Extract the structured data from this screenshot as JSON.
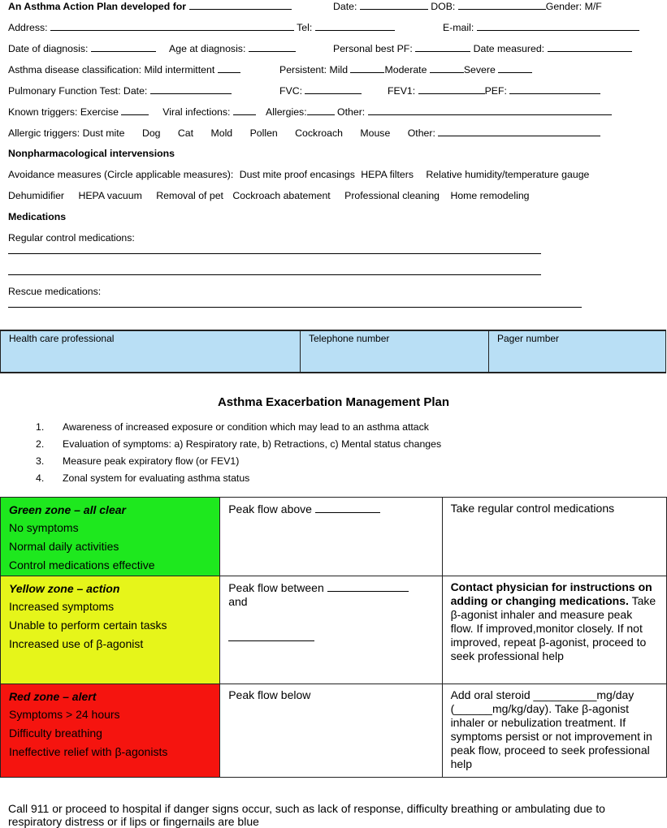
{
  "form": {
    "title": "An Asthma Action Plan developed for",
    "date_label": "Date:",
    "dob_label": "DOB:",
    "gender_label": "Gender: M/F",
    "address_label": "Address:",
    "tel_label": "Tel:",
    "email_label": "E-mail:",
    "date_of_diagnosis_label": "Date of diagnosis:",
    "age_at_diagnosis_label": "Age at diagnosis:",
    "personal_best_label": "Personal best PF:",
    "date_measured_label": "Date measured:",
    "classification_label": "Asthma disease classification: Mild intermittent",
    "persistent_label": "Persistent:  Mild",
    "moderate_label": "Moderate",
    "severe_label": "Severe",
    "pft_label": "Pulmonary Function Test: Date:",
    "fvc_label": "FVC:",
    "fev1_label": "FEV1:",
    "pef_label": "PEF:",
    "known_triggers_label": "Known triggers: Exercise",
    "viral_label": "Viral infections:",
    "allergies_label": "Allergies:",
    "other_label": "Other:",
    "allergic_triggers_label": "Allergic triggers: Dust mite",
    "allergic_triggers": [
      "Dog",
      "Cat",
      "Mold",
      "Pollen",
      "Cockroach",
      "Mouse"
    ],
    "allergic_other_label": "Other:"
  },
  "nonpharm": {
    "heading": "Nonpharmacological intervensions",
    "avoidance_label": "Avoidance measures (Circle applicable measures):",
    "measures_row1": [
      "Dust mite proof encasings",
      "HEPA filters",
      "Relative humidity/temperature gauge"
    ],
    "measures_row2": [
      "Dehumidifier",
      "HEPA vacuum",
      "Removal of pet",
      "Cockroach abatement",
      "Professional cleaning",
      "Home remodeling"
    ]
  },
  "medications": {
    "heading": "Medications",
    "regular_label": "Regular control medications:",
    "rescue_label": "Rescue medications:"
  },
  "contacts": {
    "headers": [
      "Health care professional",
      "Telephone number",
      "Pager number"
    ],
    "color": "#b9dff5"
  },
  "plan": {
    "title": "Asthma Exacerbation Management Plan",
    "steps": [
      {
        "num": "1.",
        "text": "Awareness of increased exposure or condition which may lead to an asthma attack"
      },
      {
        "num": "2.",
        "text": "Evaluation of symptoms: a) Respiratory rate, b) Retractions, c) Mental status changes"
      },
      {
        "num": "3.",
        "text": "Measure peak expiratory flow (or FEV1)"
      },
      {
        "num": "4.",
        "text": "Zonal system for evaluating asthma status"
      }
    ]
  },
  "zones": [
    {
      "title": "Green zone – all clear",
      "color": "#1ee81e",
      "lines": [
        "No symptoms",
        "Normal daily activities",
        "Control medications effective"
      ],
      "flow": "Peak flow above",
      "action_bold": "",
      "action": "Take regular control medications"
    },
    {
      "title": "Yellow zone – action",
      "color": "#e6f51a",
      "lines": [
        "Increased symptoms",
        "Unable to perform certain tasks",
        "Increased use of β-agonist"
      ],
      "flow": "Peak flow between",
      "flow_and": "and",
      "action_bold": "Contact physician for instructions on adding or changing medications.",
      "action": "Take β-agonist inhaler and measure peak flow. If improved,monitor closely. If not improved, repeat  β-agonist, proceed to seek professional help"
    },
    {
      "title": "Red zone – alert",
      "color": "#f5140f",
      "lines": [
        "Symptoms > 24 hours",
        "Difficulty breathing",
        "Ineffective relief with β-agonists"
      ],
      "flow": "Peak flow below",
      "action_bold": "",
      "action": "Add oral steroid __________mg/day (______mg/kg/day). Take β-agonist inhaler or nebulization treatment. If symptoms persist or not improvement in peak flow, proceed to seek professional help"
    }
  ],
  "footer": "Call 911 or proceed to hospital if danger signs occur, such as lack of response, difficulty breathing or ambulating due to respiratory distress or if lips or fingernails are blue"
}
